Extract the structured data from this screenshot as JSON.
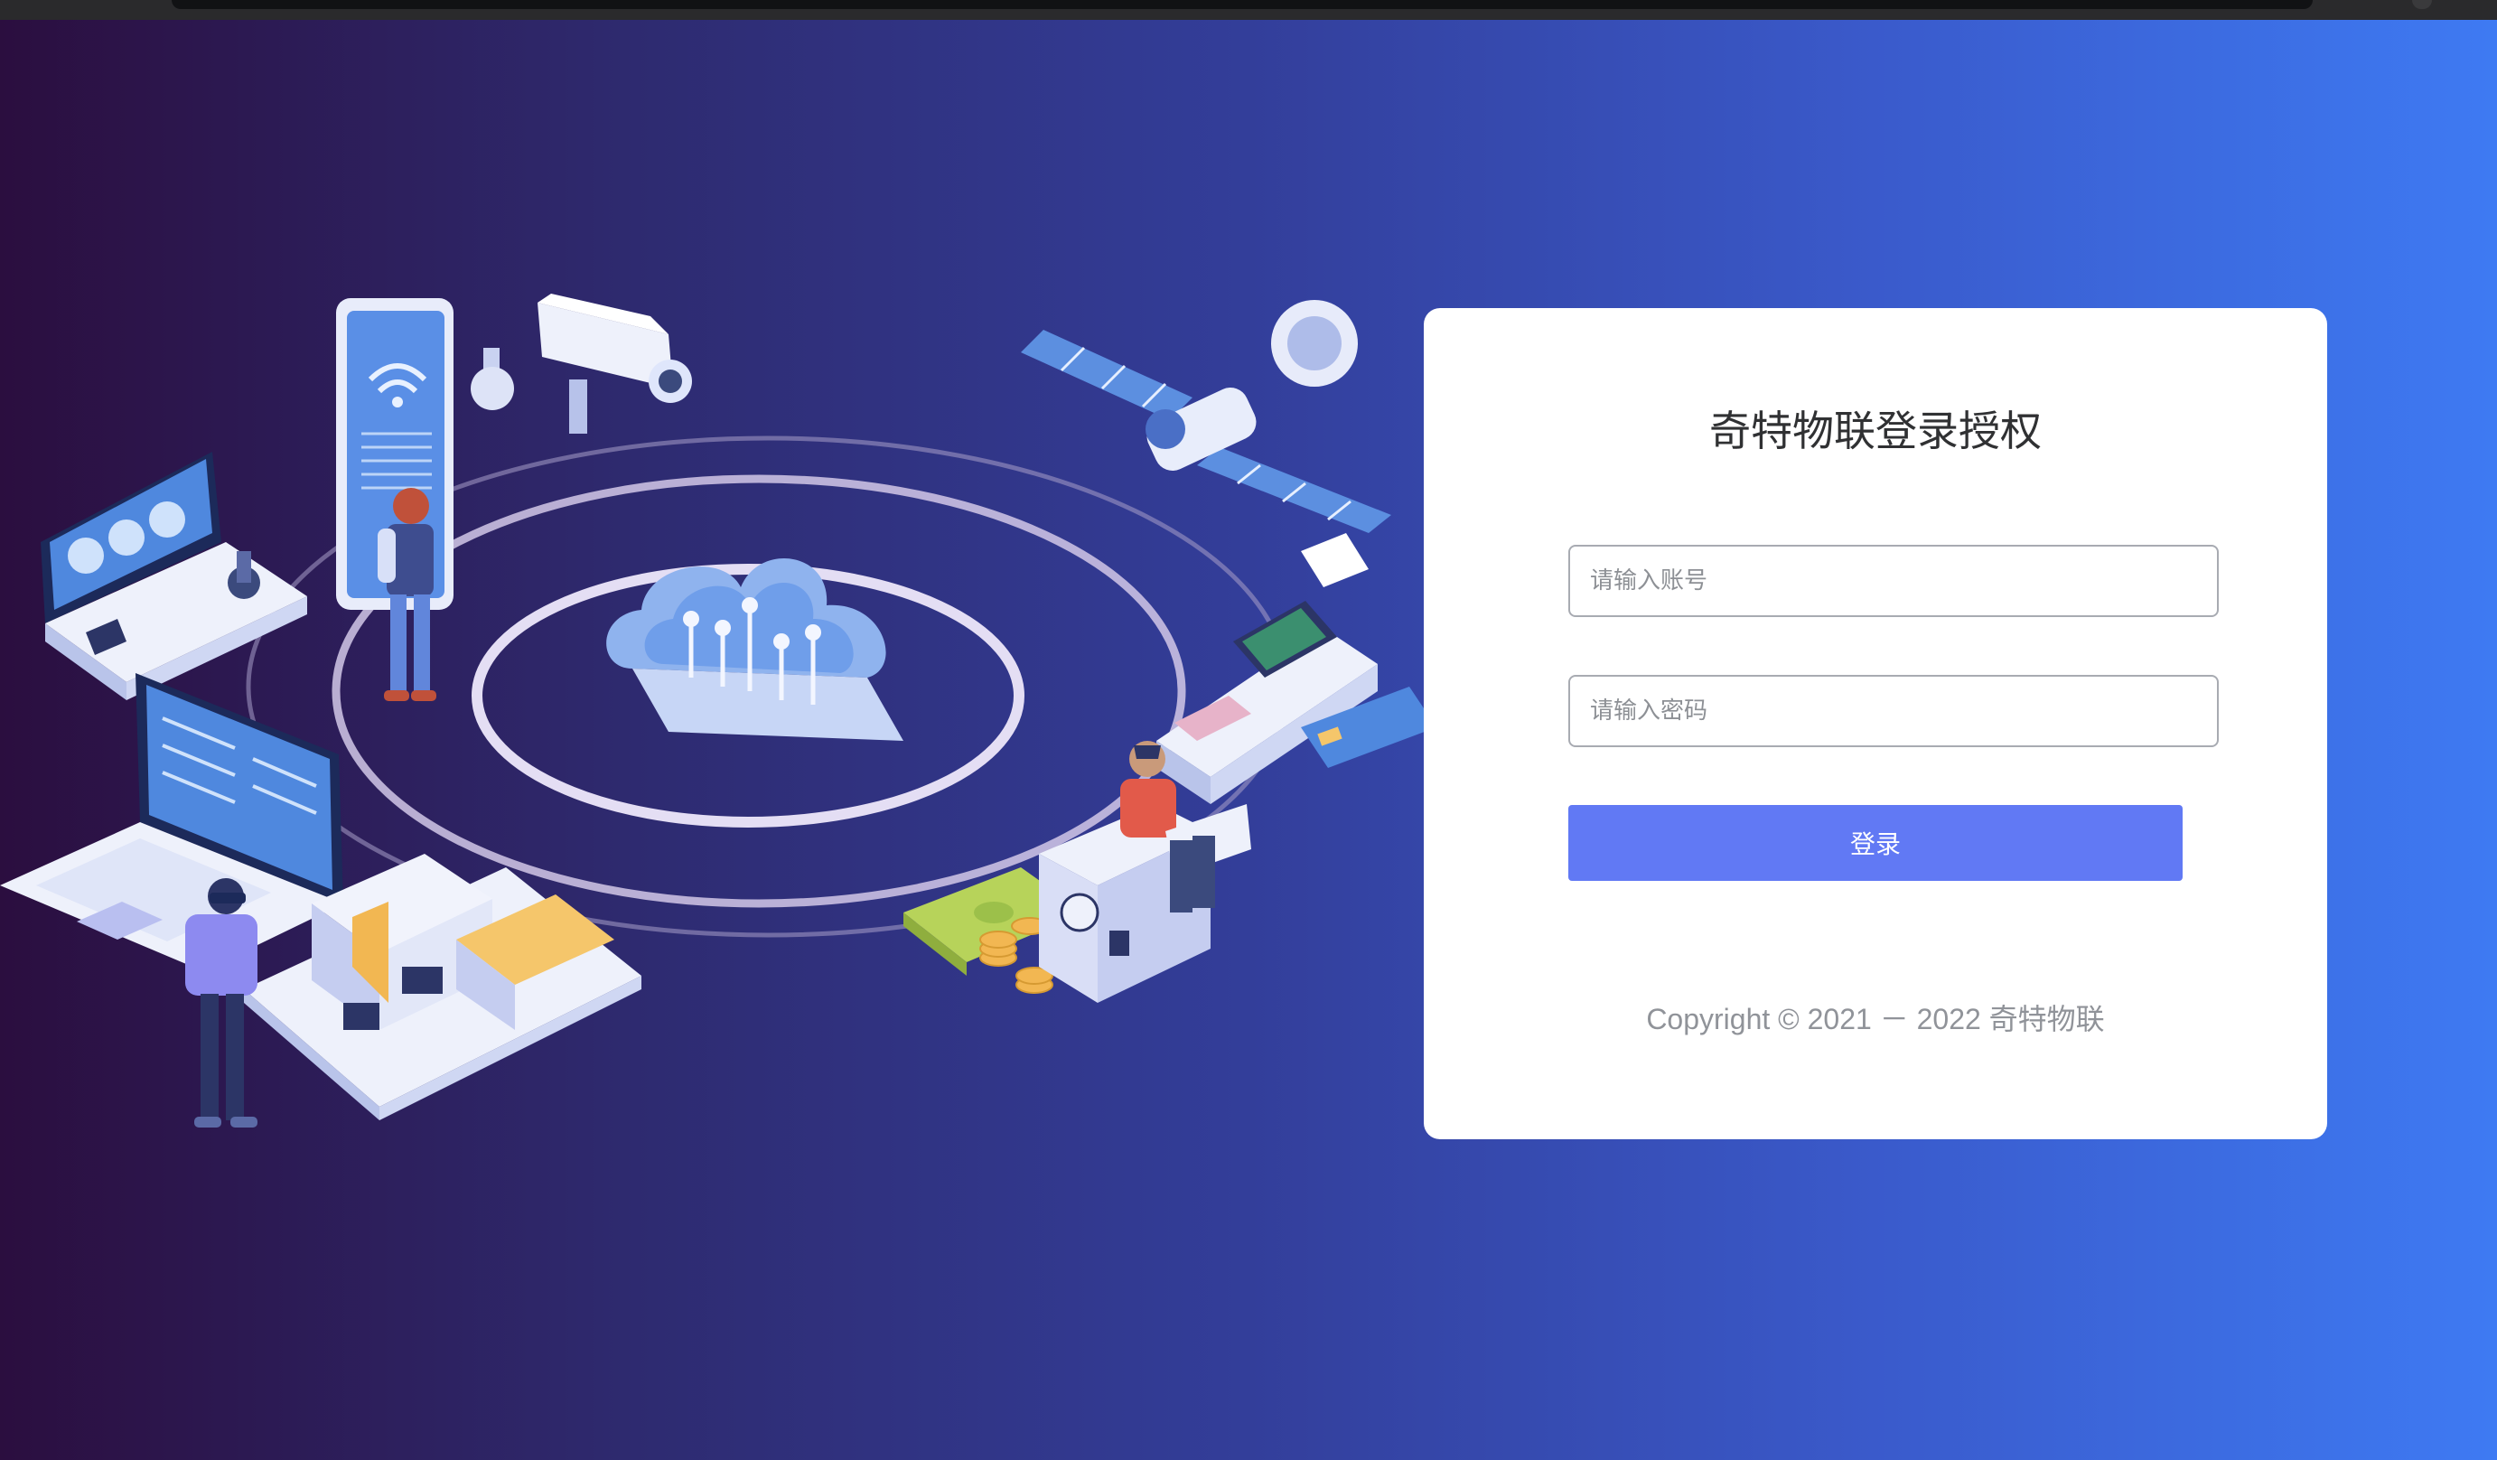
{
  "login": {
    "title": "奇特物联登录授权",
    "account_placeholder": "请输入账号",
    "account_value": "",
    "password_placeholder": "请输入密码",
    "password_value": "",
    "submit_label": "登录",
    "copyright": "Copyright © 2021 － 2022 奇特物联"
  },
  "colors": {
    "background_start": "#2b0e3f",
    "background_end": "#3e7af3",
    "button": "#6179f4",
    "card": "#ffffff"
  },
  "illustration": {
    "icons": [
      "smartphone-wifi-icon",
      "security-camera-icon",
      "satellite-icon",
      "cloud-icon",
      "game-console-icon",
      "laptop-icon",
      "pos-terminal-icon",
      "credit-card-icon",
      "safe-icon",
      "money-coins-icon",
      "buildings-icon"
    ]
  }
}
